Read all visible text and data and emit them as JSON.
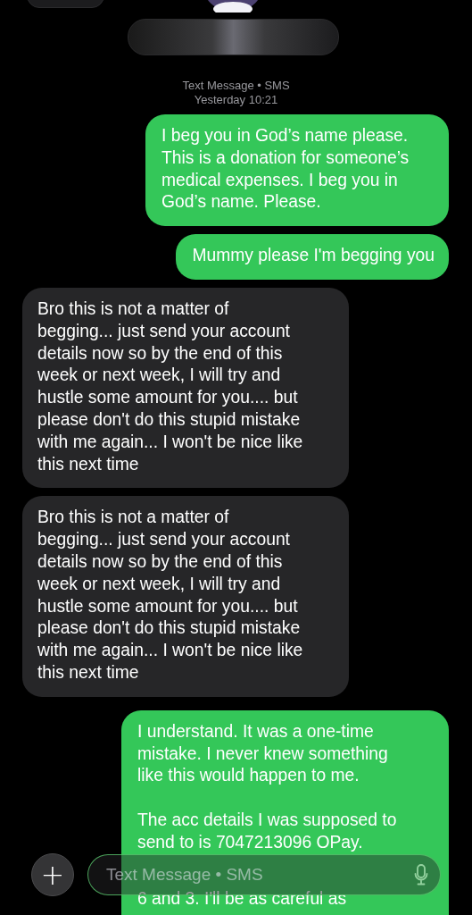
{
  "header": {
    "service": "Text Message • SMS",
    "time": "Yesterday 10:21"
  },
  "messages": [
    {
      "kind": "sent",
      "paragraphs": [
        "I beg you in God’s name please.\nThis is a donation for someone’s\nmedical expenses. I beg you in\nGod’s name. Please."
      ]
    },
    {
      "kind": "sent",
      "paragraphs": [
        "Mummy please I'm begging you"
      ]
    },
    {
      "kind": "received",
      "paragraphs": [
        "Bro this is not a matter of\nbegging... just send your account\ndetails now so by the end of this\nweek or next week, I will try and\nhustle some amount for you.... but\nplease don't do this stupid mistake\nwith me again... I won't be nice like\nthis next time"
      ]
    },
    {
      "kind": "received",
      "paragraphs": [
        "Bro this is not a matter of\nbegging... just send your account\ndetails now so by the end of this\nweek or next week, I will try and\nhustle some amount for you.... but\nplease don't do this stupid mistake\nwith me again... I won't be nice like\nthis next time"
      ]
    },
    {
      "kind": "sent",
      "paragraphs": [
        "I understand. It was a one-time\nmistake. I never knew something\nlike this would happen to me.",
        "The acc details I was supposed to\nsend to is 7047213096 OPay."
      ],
      "trailing": "6 and 3. I'll be as careful as"
    }
  ],
  "composer": {
    "placeholder": "Text Message • SMS",
    "add_symbol": "+"
  }
}
